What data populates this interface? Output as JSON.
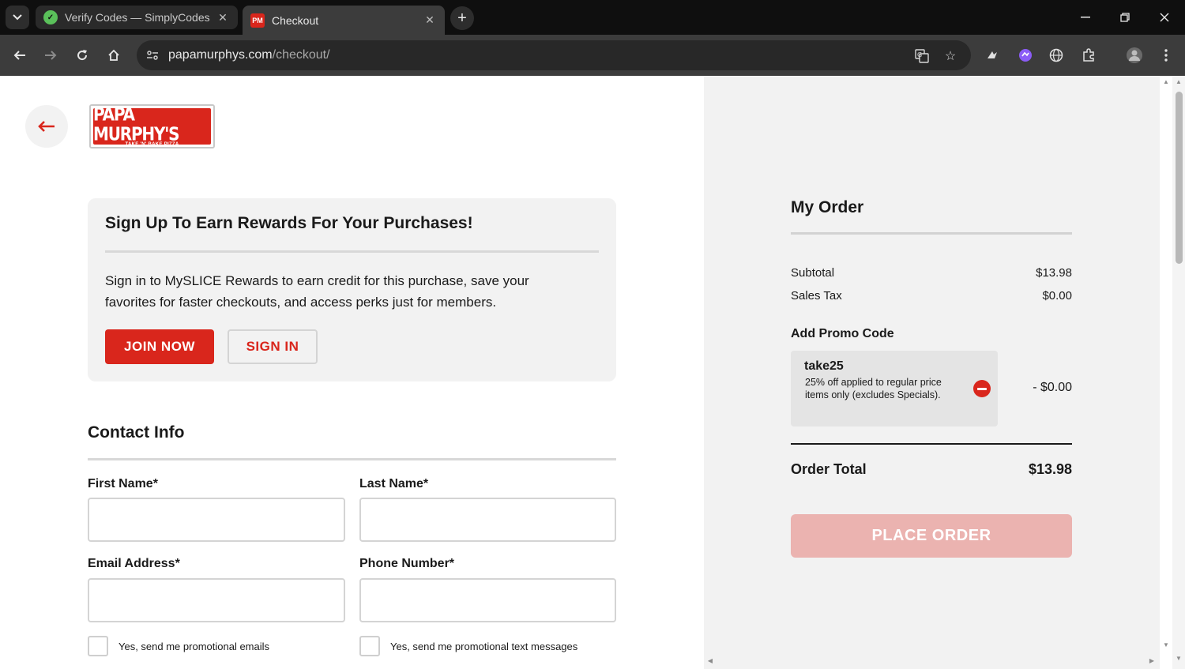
{
  "browser": {
    "tabs": [
      {
        "title": "Verify Codes — SimplyCodes",
        "active": false,
        "favicon": "simplycodes-check-icon"
      },
      {
        "title": "Checkout",
        "active": true,
        "favicon": "papa-murphys-pm-icon",
        "favicon_text": "PM"
      }
    ],
    "url_domain": "papamurphys.com",
    "url_path": "/checkout/"
  },
  "header": {
    "logo_text": "PAPA MURPHY'S",
    "logo_tagline": "TAKE 'N' BAKE PIZZA"
  },
  "rewards": {
    "title": "Sign Up To Earn Rewards For Your Purchases!",
    "body": "Sign in to MySLICE Rewards to earn credit for this purchase, save your favorites for faster checkouts, and access perks just for members.",
    "join_label": "JOIN NOW",
    "signin_label": "SIGN IN"
  },
  "contact": {
    "title": "Contact Info",
    "first_name_label": "First Name*",
    "first_name_value": "",
    "last_name_label": "Last Name*",
    "last_name_value": "",
    "email_label": "Email Address*",
    "email_value": "",
    "phone_label": "Phone Number*",
    "phone_value": "",
    "promo_emails_label": "Yes, send me promotional emails",
    "promo_emails_checked": false,
    "promo_texts_label": "Yes, send me promotional text messages",
    "promo_texts_checked": false
  },
  "order": {
    "title": "My Order",
    "subtotal_label": "Subtotal",
    "subtotal_value": "$13.98",
    "tax_label": "Sales Tax",
    "tax_value": "$0.00",
    "promo_heading": "Add Promo Code",
    "promo_code": "take25",
    "promo_description": "25% off applied to regular price items only (excludes Specials).",
    "promo_discount": "- $0.00",
    "total_label": "Order Total",
    "total_value": "$13.98",
    "place_order_label": "PLACE ORDER",
    "place_order_enabled": false
  },
  "colors": {
    "brand_red": "#d9261c",
    "disabled_button": "#ebb3b0",
    "summary_bg": "#f2f2f2"
  }
}
